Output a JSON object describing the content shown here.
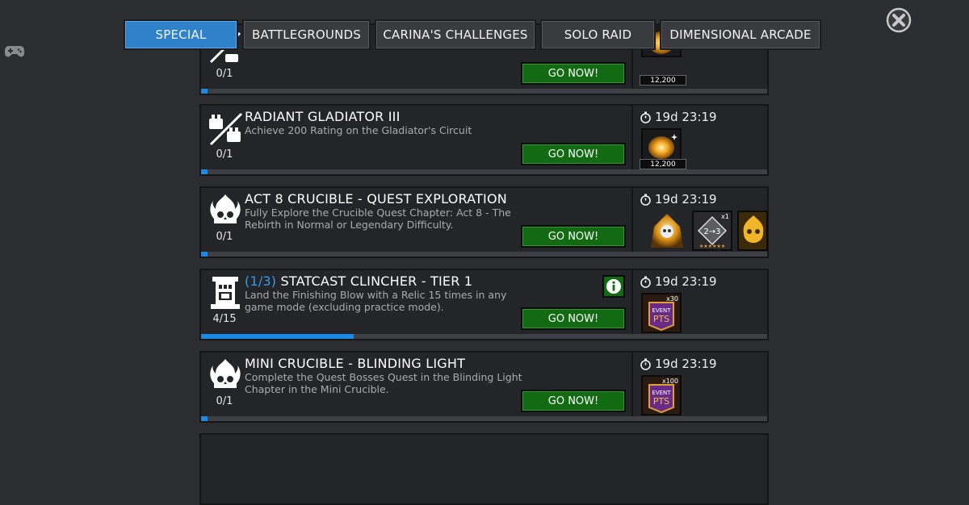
{
  "tabs": [
    {
      "label": "SPECIAL",
      "active": true
    },
    {
      "label": "BATTLEGROUNDS",
      "active": false
    },
    {
      "label": "CARINA'S CHALLENGES",
      "active": false
    },
    {
      "label": "SOLO RAID",
      "active": false
    },
    {
      "label": "DIMENSIONAL ARCADE",
      "active": false
    }
  ],
  "cards": [
    {
      "title_prefix": "",
      "title": "",
      "desc": "",
      "count": "0/1",
      "go": "GO NOW!",
      "timer": "",
      "progress": 0.005,
      "rewards": [
        {
          "icon": "gold-orb-icon",
          "qty": "12,200"
        }
      ]
    },
    {
      "title_prefix": "",
      "title": "RADIANT GLADIATOR III",
      "desc": "Achieve 200 Rating on the Gladiator's Circuit",
      "count": "0/1",
      "go": "GO NOW!",
      "timer": "19d 23:19",
      "progress": 0.005,
      "rewards": [
        {
          "icon": "gold-orb-icon",
          "qty": "12,200"
        }
      ]
    },
    {
      "title_prefix": "",
      "title": "ACT 8 CRUCIBLE - QUEST EXPLORATION",
      "desc": "Fully Explore the Crucible Quest Chapter: Act 8 - The Rebirth in Normal or Legendary Difficulty.",
      "count": "0/1",
      "go": "GO NOW!",
      "timer": "19d 23:19",
      "progress": 0.005,
      "rewards": [
        {
          "icon": "gold-crystal-icon"
        },
        {
          "icon": "rank-up-gem-icon",
          "badge": "x1"
        },
        {
          "icon": "gold-skull-icon"
        }
      ]
    },
    {
      "title_prefix": "(1/3)",
      "title": "STATCAST CLINCHER - TIER 1",
      "desc": "Land the Finishing Blow with a Relic 15 times in any game mode (excluding practice mode).",
      "count": "4/15",
      "go": "GO NOW!",
      "timer": "19d 23:19",
      "progress": 0.27,
      "rewards": [
        {
          "icon": "event-pts-icon",
          "badge": "x30"
        }
      ]
    },
    {
      "title_prefix": "",
      "title": "MINI CRUCIBLE - BLINDING LIGHT",
      "desc": "Complete the Quest Bosses Quest in the Blinding Light Chapter in the Mini Crucible.",
      "count": "0/1",
      "go": "GO NOW!",
      "timer": "19d 23:19",
      "progress": 0.005,
      "rewards": [
        {
          "icon": "event-pts-icon",
          "badge": "x100"
        }
      ]
    }
  ],
  "colors": {
    "accent": "#2f82c9",
    "go_button": "#126b12",
    "progress": "#1e88e5",
    "title_prefix": "#3a98e8"
  }
}
